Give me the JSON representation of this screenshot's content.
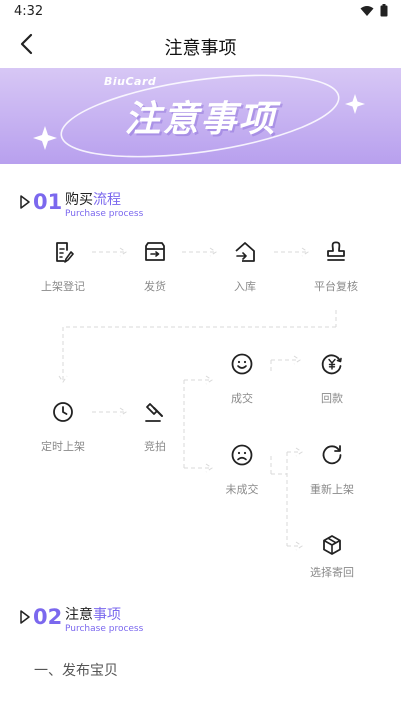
{
  "status_bar": {
    "time": "4:32"
  },
  "header": {
    "title": "注意事项"
  },
  "banner": {
    "brand": "BiuCard",
    "title": "注意事项"
  },
  "section1": {
    "number": "01",
    "title_plain": "购买",
    "title_highlight": "流程",
    "subtitle": "Purchase process"
  },
  "flow": {
    "step_1": "上架登记",
    "step_2": "发货",
    "step_3": "入库",
    "step_4": "平台复核",
    "step_5": "定时上架",
    "step_6": "竞拍",
    "step_7": "成交",
    "step_8": "未成交",
    "step_9": "回款",
    "step_10": "重新上架",
    "step_11": "选择寄回"
  },
  "section2": {
    "number": "02",
    "title_plain": "注意",
    "title_highlight": "事项",
    "subtitle": "Purchase process"
  },
  "content": {
    "item_1": "一、发布宝贝"
  },
  "colors": {
    "accent": "#7b68ee",
    "banner_bg": "#c2aef0"
  }
}
